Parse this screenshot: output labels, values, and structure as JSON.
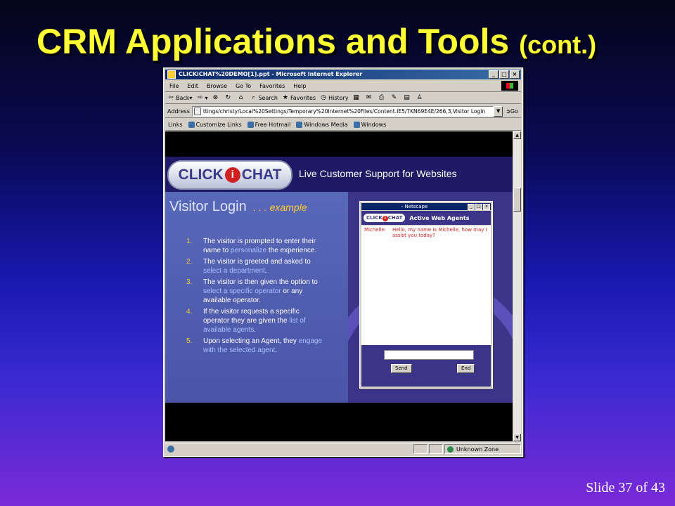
{
  "slide": {
    "title": "CRM Applications and Tools",
    "title_suffix": "(cont.)",
    "footer": "Slide 37 of 43"
  },
  "browser": {
    "window_title": "CLICKiCHAT%20DEMO[1].ppt - Microsoft Internet Explorer",
    "window_buttons": [
      "_",
      "□",
      "×"
    ],
    "menu": [
      "File",
      "Edit",
      "Browse",
      "Go To",
      "Favorites",
      "Help"
    ],
    "toolbar": {
      "back": "Back",
      "search": "Search",
      "favorites": "Favorites",
      "history": "History"
    },
    "address_label": "Address",
    "address_value": "ttings/christy/Local%20Settings/Temporary%20Internet%20Files/Content.IE5/7KN69E4E/266,3,Visitor Login",
    "go_label": "Go",
    "links_label": "Links",
    "links": [
      "Customize Links",
      "Free Hotmail",
      "Windows Media",
      "Windows"
    ],
    "status_zone": "Unknown Zone"
  },
  "page": {
    "logo_left": "CLICK",
    "logo_i": "i",
    "logo_right": "CHAT",
    "tagline": "Live Customer Support for Websites",
    "visitor_title": "Visitor Login",
    "example": ". . .  example",
    "steps": [
      {
        "num": "1.",
        "a": "The visitor is prompted to enter their name to ",
        "h": "personalize",
        "b": " the experience."
      },
      {
        "num": "2.",
        "a": "The visitor is greeted and asked to ",
        "h": "select a department",
        "b": "."
      },
      {
        "num": "3.",
        "a": "The visitor is then given the option to ",
        "h": "select a specific operator",
        "b": " or any available operator."
      },
      {
        "num": "4.",
        "a": "If the visitor requests a specific operator they are given the ",
        "h": "list of available agents",
        "b": "."
      },
      {
        "num": "5.",
        "a": "Upon selecting an Agent, they ",
        "h": "engage with the selected agent",
        "b": "."
      }
    ]
  },
  "chat_window": {
    "title": "- Netscape",
    "logo_left": "CLICK",
    "logo_i": "i",
    "logo_right": "CHAT",
    "header": "Active Web Agents",
    "messages": [
      {
        "who": "Michelle:",
        "text": "Hello, my name is Michelle, how may I assist you today?"
      }
    ],
    "send_label": "Send",
    "end_label": "End"
  },
  "colors": {
    "title_yellow": "#ffff33",
    "accent_orange": "#ffcc33",
    "chat_red": "#d02020"
  }
}
